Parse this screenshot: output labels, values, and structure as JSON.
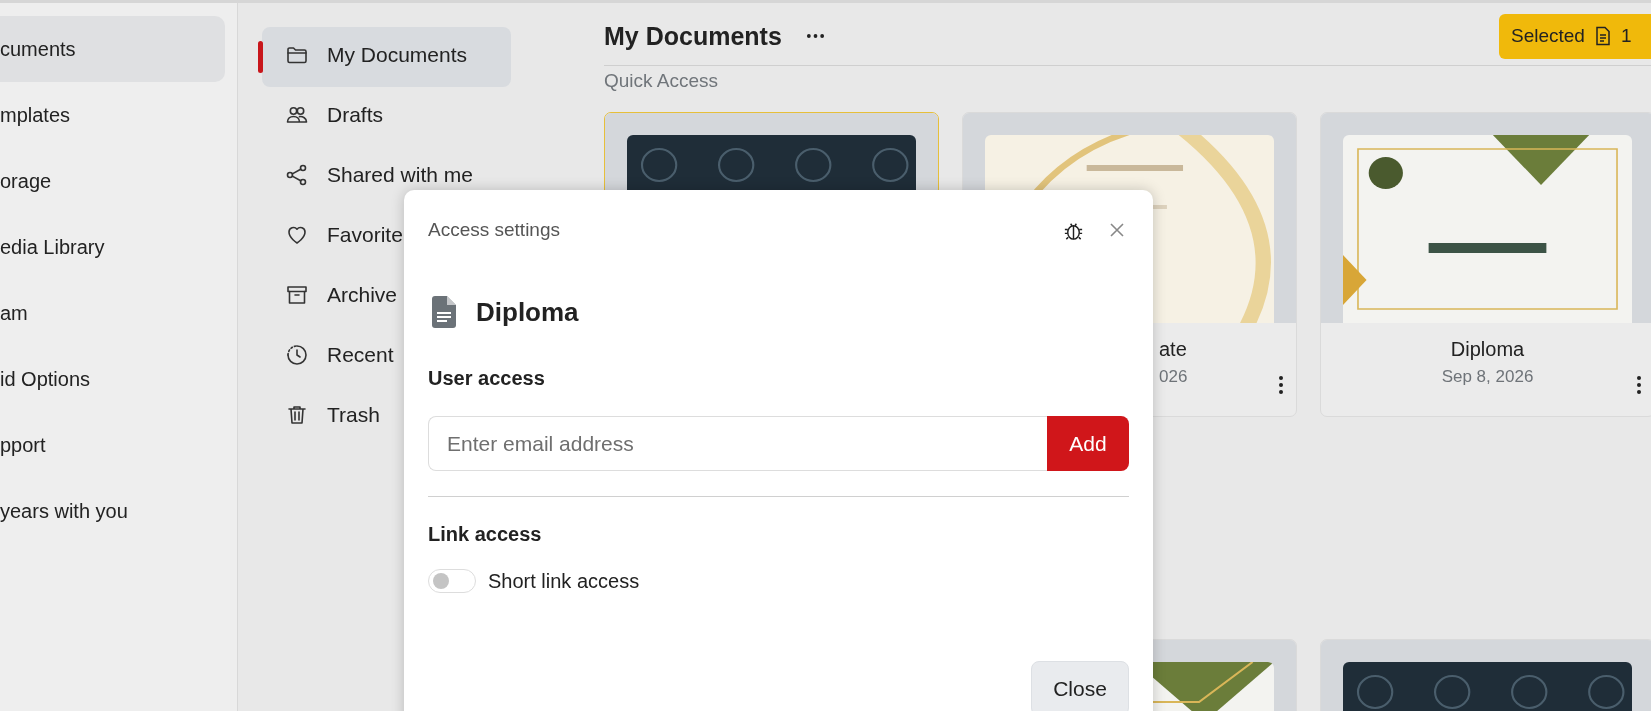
{
  "sidebar": {
    "items": [
      {
        "label": "cuments",
        "selected": true
      },
      {
        "label": "mplates",
        "selected": false
      },
      {
        "label": "orage",
        "selected": false
      },
      {
        "label": "edia Library",
        "selected": false
      },
      {
        "label": "am",
        "selected": false
      },
      {
        "label": "id Options",
        "selected": false
      },
      {
        "label": "pport",
        "selected": false
      },
      {
        "label": "years with you",
        "selected": false
      }
    ]
  },
  "nav": {
    "items": [
      {
        "label": "My Documents",
        "selected": true
      },
      {
        "label": "Drafts",
        "selected": false
      },
      {
        "label": "Shared with me",
        "selected": false
      },
      {
        "label": "Favorite",
        "selected": false
      },
      {
        "label": "Archive",
        "selected": false
      },
      {
        "label": "Recent",
        "selected": false
      },
      {
        "label": "Trash",
        "selected": false
      }
    ]
  },
  "main": {
    "title": "My Documents",
    "section": "Quick Access",
    "selected_button": {
      "label": "Selected",
      "count": "1"
    }
  },
  "cards": [
    {
      "kind": "picture",
      "selected": true
    },
    {
      "kind": "picture",
      "title": "ate",
      "date": "026",
      "selected": false
    },
    {
      "kind": "picture",
      "title": "Diploma",
      "date": "Sep 8, 2026",
      "selected": false
    }
  ],
  "more_cards": [
    {
      "kind": "picture"
    },
    {
      "kind": "picture"
    }
  ],
  "dialog": {
    "title": "Access settings",
    "document": "Diploma",
    "user_access": {
      "heading": "User access",
      "placeholder": "Enter email address",
      "button": "Add"
    },
    "link_access": {
      "heading": "Link access",
      "toggle": {
        "label": "Short link access",
        "on": false
      }
    },
    "buttons": [
      "Close"
    ]
  }
}
